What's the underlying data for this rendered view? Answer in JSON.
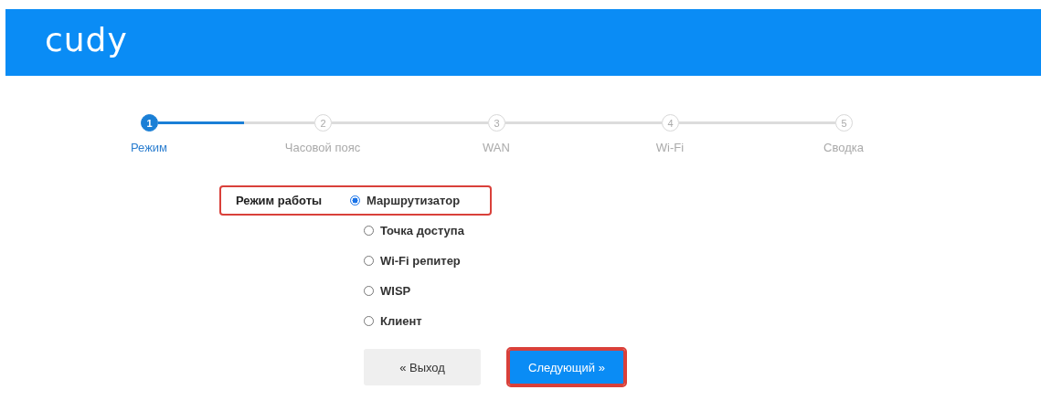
{
  "header": {
    "logo": "cudy"
  },
  "stepper": {
    "connectors": [
      {
        "kind": "progress",
        "level": 0.55
      },
      {
        "kind": "plain"
      },
      {
        "kind": "plain"
      },
      {
        "kind": "plain"
      }
    ],
    "steps": [
      {
        "number": "1",
        "label": "Режим",
        "selected": true
      },
      {
        "number": "2",
        "label": "Часовой пояс",
        "selected": false
      },
      {
        "number": "3",
        "label": "WAN",
        "selected": false
      },
      {
        "number": "4",
        "label": "Wi-Fi",
        "selected": false
      },
      {
        "number": "5",
        "label": "Сводка",
        "selected": false
      }
    ]
  },
  "mode": {
    "label": "Режим работы",
    "highlighted": true,
    "options": [
      {
        "label": "Маршрутизатор",
        "selected": true
      },
      {
        "label": "Точка доступа",
        "selected": false
      },
      {
        "label": "Wi-Fi репитер",
        "selected": false
      },
      {
        "label": "WISP",
        "selected": false
      },
      {
        "label": "Клиент",
        "selected": false
      }
    ]
  },
  "buttons": [
    {
      "kind": "secondary",
      "label": "« Выход",
      "highlighted": false
    },
    {
      "kind": "primary",
      "label": "Следующий »",
      "highlighted": true
    }
  ]
}
